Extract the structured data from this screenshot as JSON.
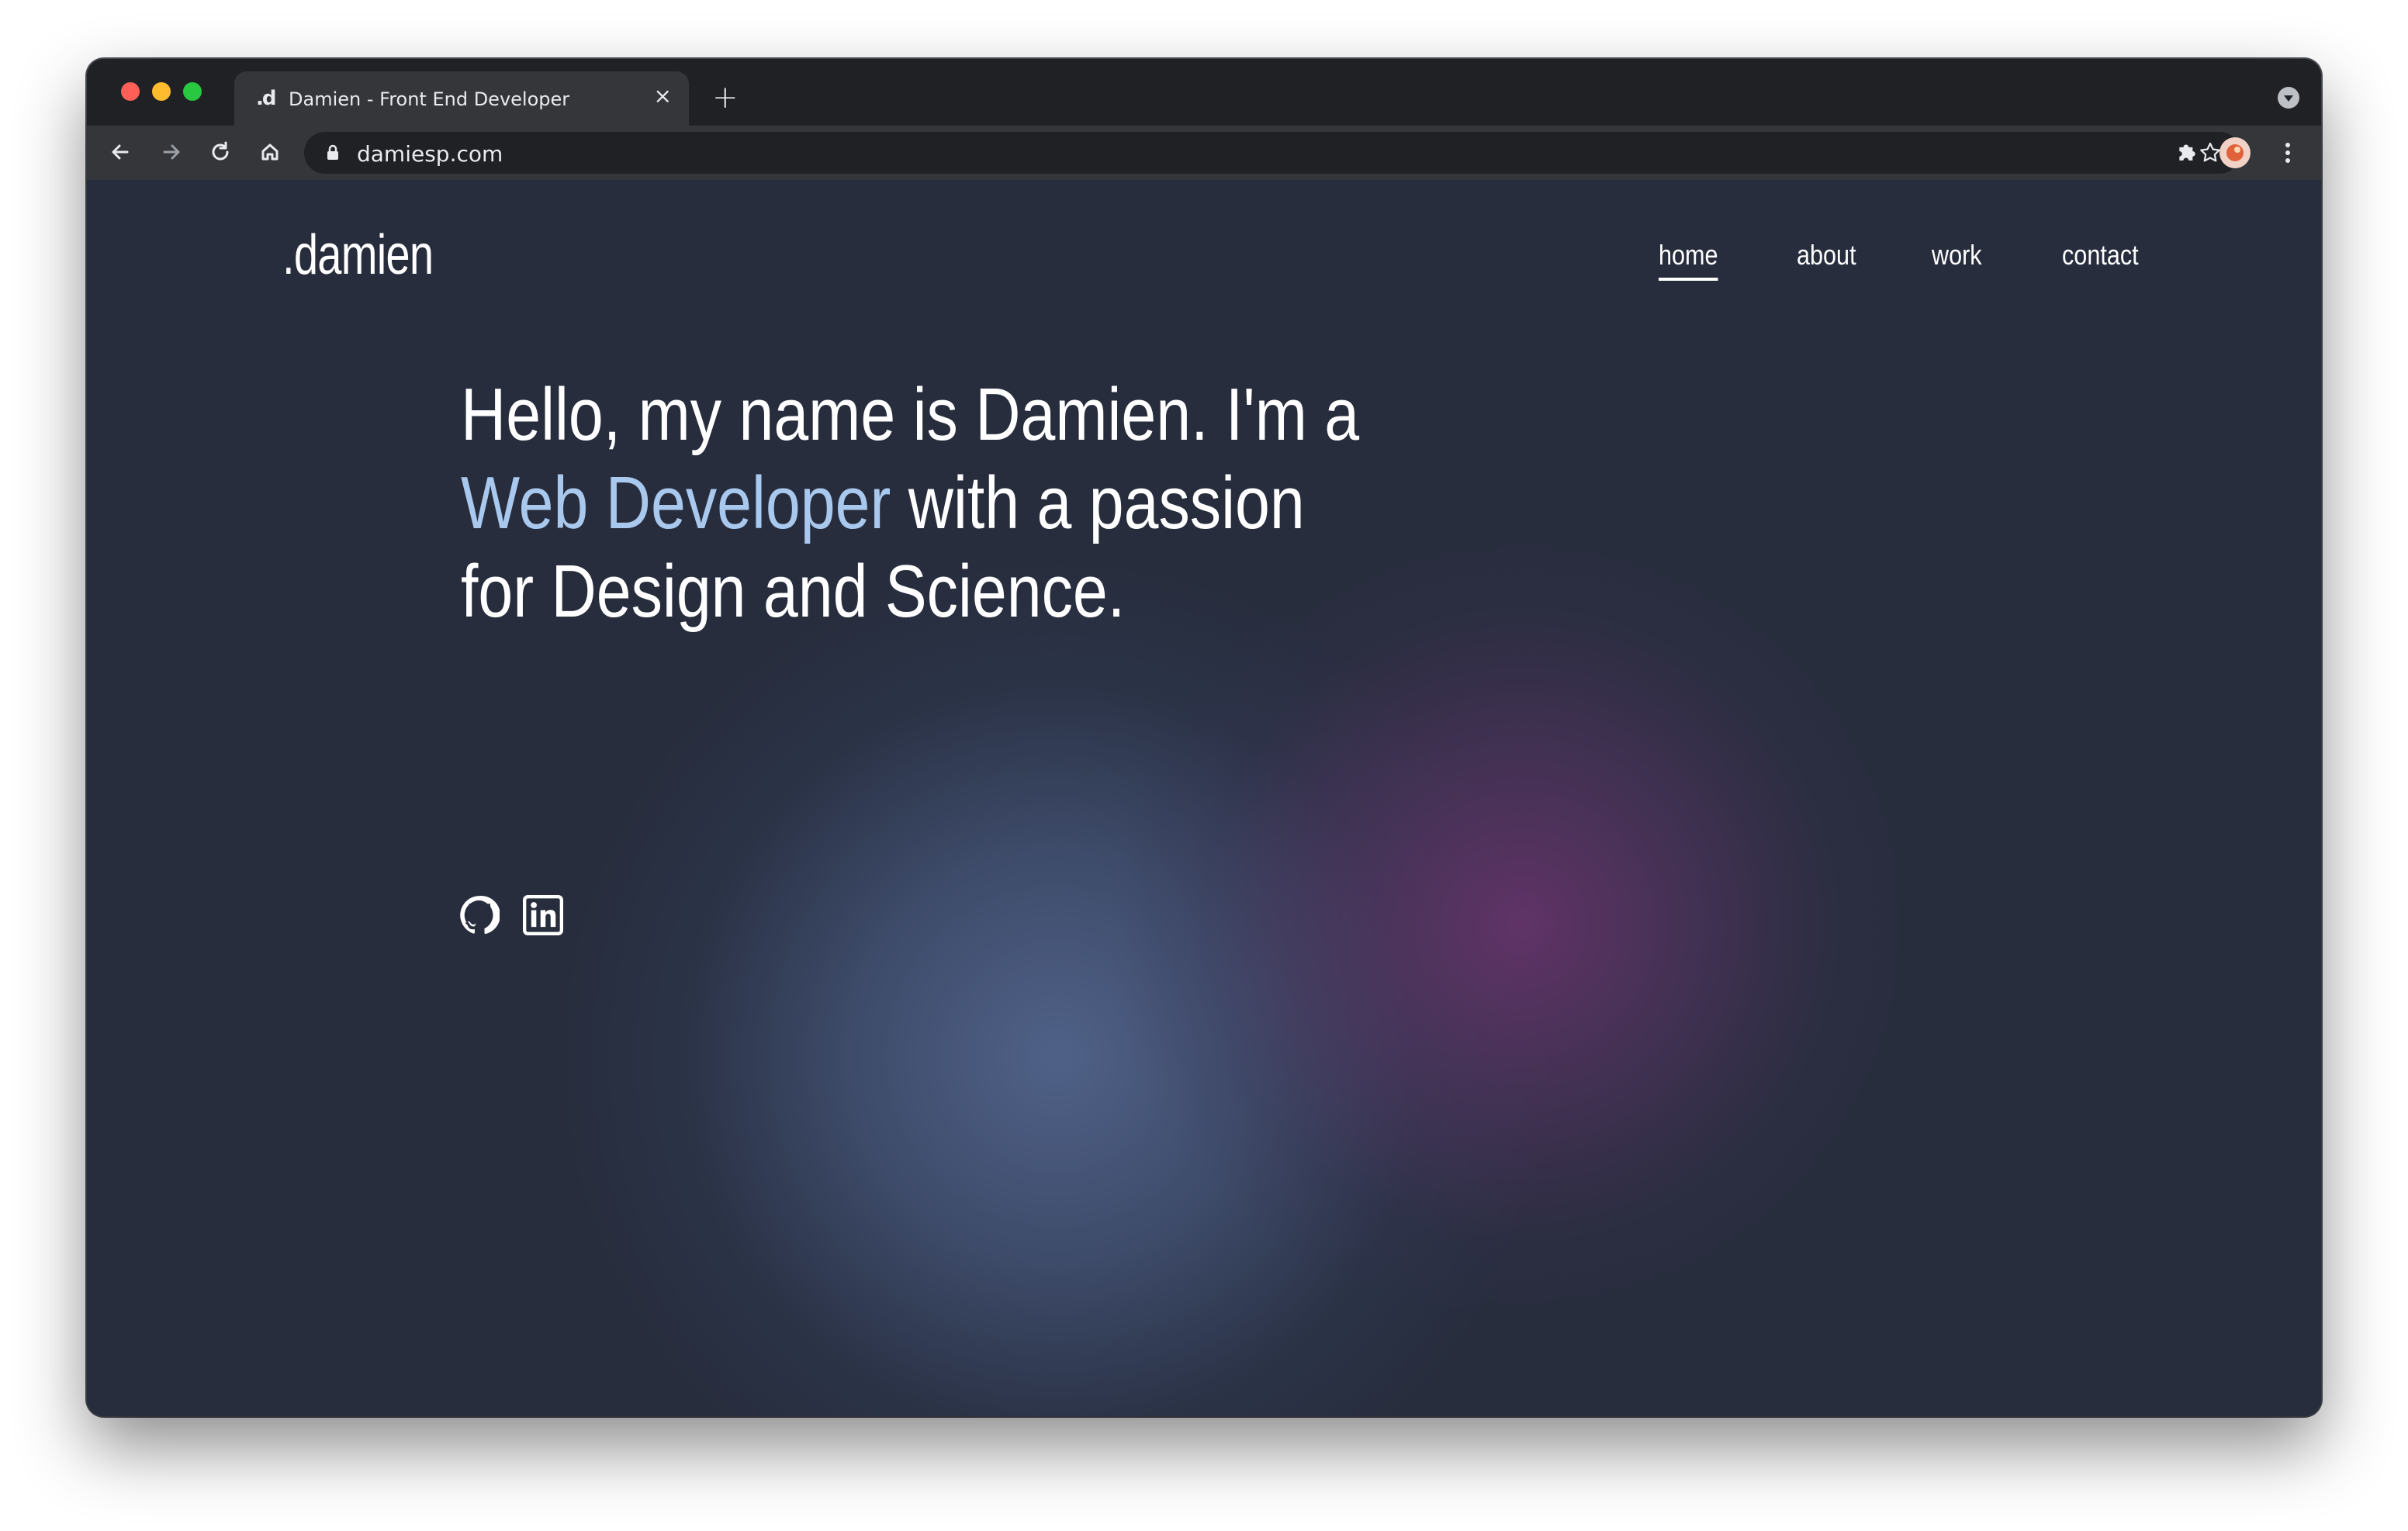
{
  "browser": {
    "tab": {
      "favicon": ".d",
      "title": "Damien - Front End Developer",
      "close": "×"
    },
    "new_tab": "+",
    "url": "damiesp.com"
  },
  "site": {
    "logo": ".damien",
    "nav": [
      {
        "label": "home",
        "active": true
      },
      {
        "label": "about",
        "active": false
      },
      {
        "label": "work",
        "active": false
      },
      {
        "label": "contact",
        "active": false
      }
    ],
    "hero": {
      "line1": "Hello, my name is Damien. I'm a",
      "accent": "Web Developer",
      "line2_rest": " with a passion",
      "line3": "for Design and Science."
    },
    "social_icons": [
      "github-icon",
      "linkedin-icon"
    ],
    "colors": {
      "background": "#272d3d",
      "accent": "#a9c8ee",
      "glow_blue": "#52648c",
      "glow_purple": "#6a346e"
    }
  }
}
